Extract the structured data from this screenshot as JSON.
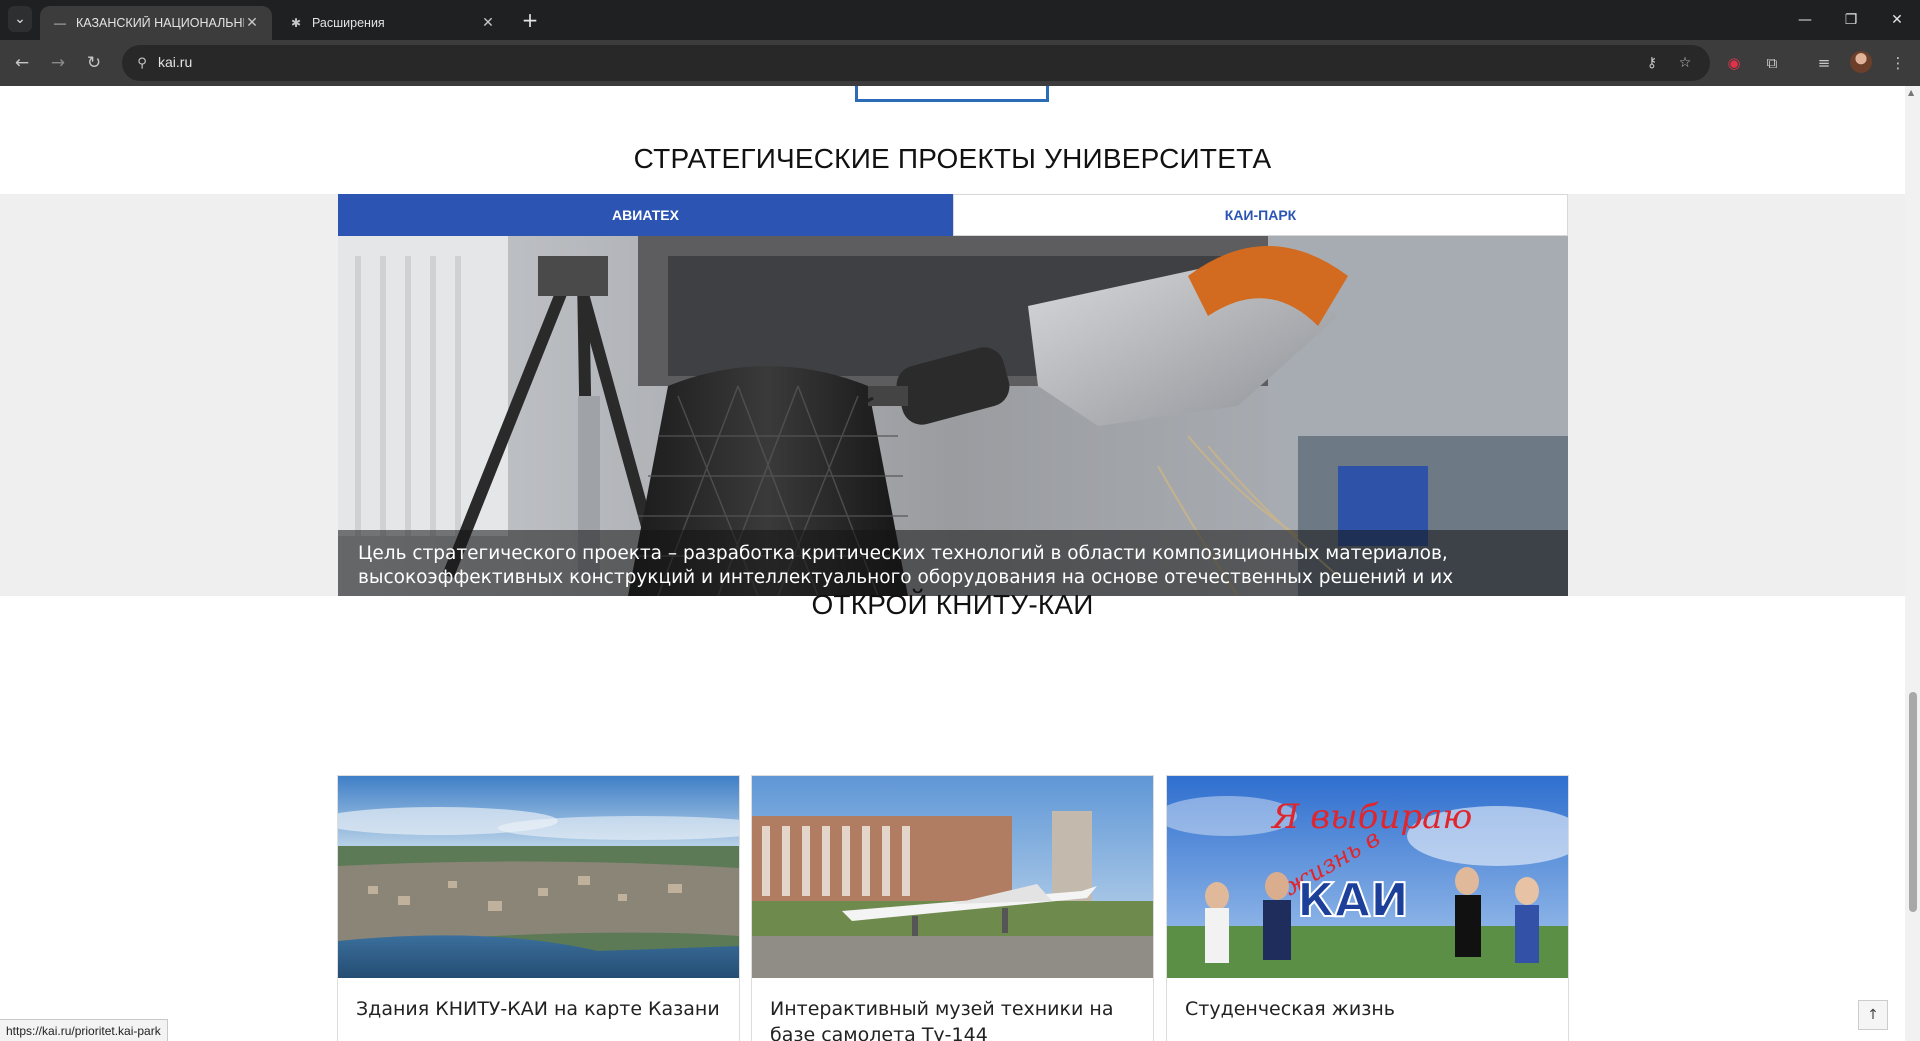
{
  "browser": {
    "tabs": [
      {
        "title": "КАЗАНСКИЙ НАЦИОНАЛЬНЫЙ",
        "active": true
      },
      {
        "title": "Расширения",
        "active": false
      }
    ],
    "url": "kai.ru",
    "icons": {
      "tab_menu": "chevron-down-icon",
      "new_tab": "plus-icon",
      "back": "arrow-left-icon",
      "forward": "arrow-right-icon",
      "reload": "reload-icon",
      "site_info": "tune-icon",
      "password": "key-icon",
      "bookmark": "star-icon",
      "extensions": "puzzle-icon",
      "menu": "kebab-icon"
    },
    "glyphs": {
      "chevron": "⌄",
      "close": "✕",
      "plus": "+",
      "back": "←",
      "forward": "→",
      "reload": "↻",
      "tune": "⚲",
      "key": "⚷",
      "star": "☆",
      "record": "◉",
      "puzzle": "⧉",
      "media": "≡",
      "kebab": "⋮",
      "minimize": "—",
      "restore": "❐",
      "win_close": "✕",
      "puzzle_fav": "✱",
      "dash_fav": "—"
    }
  },
  "page": {
    "strategic_title": "СТРАТЕГИЧЕСКИЕ ПРОЕКТЫ УНИВЕРСИТЕТА",
    "project_tabs": [
      "АВИАТЕХ",
      "КАИ-ПАРК"
    ],
    "project_caption": "Цель стратегического проекта – разработка критических технологий в области композиционных материалов, высокоэффективных конструкций и интеллектуального оборудования на основе отечественных решений и их внедрение в производство...>>>",
    "discover_title": "ОТКРОЙ КНИТУ-КАИ",
    "cards": [
      {
        "label": "Здания КНИТУ-КАИ на карте Казани"
      },
      {
        "label": "Интерактивный музей техники на базе самолета Ту-144"
      },
      {
        "label": "Студенческая жизнь"
      }
    ],
    "card3_image_text": [
      "Я выбираю",
      "жизнь в",
      "КАИ"
    ],
    "scroll_top": "↑"
  },
  "status_bar": {
    "url": "https://kai.ru/prioritet.kai-park"
  },
  "colors": {
    "accent": "#2c55b3",
    "chrome_dark": "#1f2021",
    "chrome_toolbar": "#3c3c3c"
  }
}
